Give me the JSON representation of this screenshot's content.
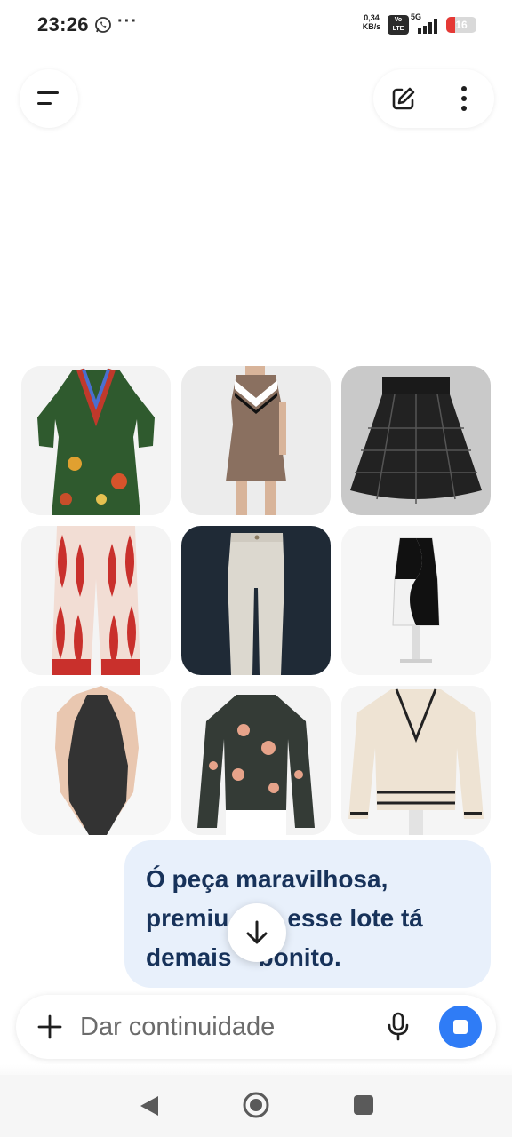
{
  "status_bar": {
    "time": "23:26",
    "more_indicator": "···",
    "net_speed_value": "0,34",
    "net_speed_unit": "KB/s",
    "volte_line1": "Vo",
    "volte_line2": "LTE",
    "network_type": "5G",
    "battery_level": "16",
    "battery_color": "#e53935",
    "icons": [
      "whatsapp-icon",
      "signal-icon",
      "battery-icon"
    ]
  },
  "header": {
    "menu_icon": "menu-icon",
    "edit_icon": "edit-icon",
    "overflow_icon": "more-vertical-icon"
  },
  "products": [
    {
      "name": "green-embroidered-dress"
    },
    {
      "name": "brown-chevron-dress"
    },
    {
      "name": "black-crochet-skirt"
    },
    {
      "name": "red-print-wide-pants"
    },
    {
      "name": "white-flare-jeans"
    },
    {
      "name": "black-white-asymmetric-dress"
    },
    {
      "name": "black-halter-bodysuit"
    },
    {
      "name": "floral-mesh-top"
    },
    {
      "name": "cream-knit-cardigan"
    }
  ],
  "message": {
    "line1": "Ó peça maravilhosa,",
    "line2_left": "premiu",
    "line2_right": "esse lote tá",
    "line3_left": "demais",
    "line3_right": "bonito."
  },
  "input": {
    "placeholder": "Dar continuidade",
    "value": ""
  },
  "colors": {
    "accent": "#2f7cf6",
    "bubble_bg": "#e8f0fb",
    "bubble_text": "#17325a"
  }
}
